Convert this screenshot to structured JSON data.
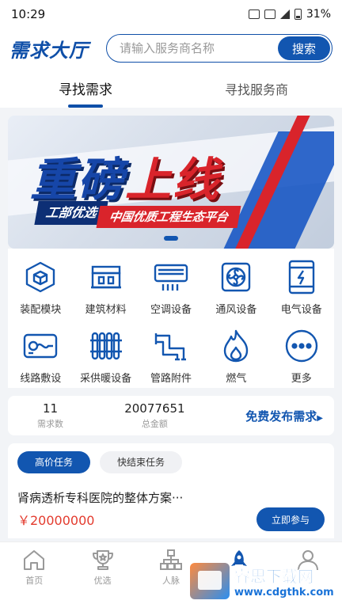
{
  "status_bar": {
    "time": "10:29",
    "battery": "31%"
  },
  "header": {
    "logo": "需求大厅",
    "search_placeholder": "请输入服务商名称",
    "search_button": "搜索"
  },
  "tabs": [
    {
      "label": "寻找需求"
    },
    {
      "label": "寻找服务商"
    }
  ],
  "banner": {
    "headline_part1": "重磅",
    "headline_part2": "上线",
    "tag1": "工部优选",
    "tag2": "中国优质工程生态平台"
  },
  "categories": [
    {
      "label": "装配模块",
      "icon": "cube-icon"
    },
    {
      "label": "建筑材料",
      "icon": "building-material-icon"
    },
    {
      "label": "空调设备",
      "icon": "air-conditioner-icon"
    },
    {
      "label": "通风设备",
      "icon": "fan-icon"
    },
    {
      "label": "电气设备",
      "icon": "electric-cabinet-icon"
    },
    {
      "label": "线路敷设",
      "icon": "cable-icon"
    },
    {
      "label": "采供暖设备",
      "icon": "radiator-icon"
    },
    {
      "label": "管路附件",
      "icon": "pipe-icon"
    },
    {
      "label": "燃气",
      "icon": "flame-icon"
    },
    {
      "label": "更多",
      "icon": "more-icon"
    }
  ],
  "stats": [
    {
      "value": "11",
      "label": "需求数"
    },
    {
      "value": "20077651",
      "label": "总金额"
    }
  ],
  "publish_label": "免费发布需求",
  "task_tabs": [
    {
      "label": "高价任务"
    },
    {
      "label": "快结束任务"
    }
  ],
  "task": {
    "title": "肾病透析专科医院的整体方案···",
    "price": "￥20000000",
    "action": "立即参与"
  },
  "bottom_nav": [
    {
      "label": "首页",
      "icon": "home-icon"
    },
    {
      "label": "优选",
      "icon": "trophy-icon"
    },
    {
      "label": "人脉",
      "icon": "network-icon"
    },
    {
      "label": "",
      "icon": "rocket-icon"
    },
    {
      "label": "",
      "icon": "user-icon"
    }
  ],
  "watermark": {
    "title": "睿思下载网",
    "url": "www.cdgthk.com"
  },
  "colors": {
    "primary": "#1256b0",
    "price": "#e33b2e",
    "accent_red": "#d9242b"
  }
}
